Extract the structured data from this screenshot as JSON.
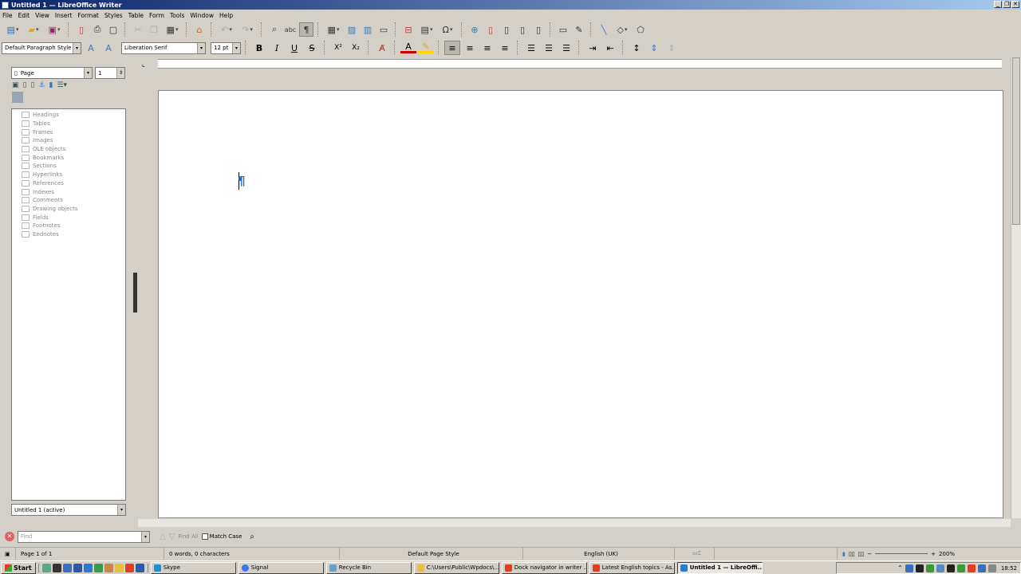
{
  "window": {
    "title": "Untitled 1 — LibreOffice Writer",
    "controls": [
      "_",
      "❐",
      "✕"
    ]
  },
  "menu": [
    "File",
    "Edit",
    "View",
    "Insert",
    "Format",
    "Styles",
    "Table",
    "Form",
    "Tools",
    "Window",
    "Help"
  ],
  "formatting": {
    "paragraph_style": "Default Paragraph Style",
    "font_name": "Liberation Serif",
    "font_size": "12 pt",
    "bold": "B",
    "italic": "I",
    "underline": "U",
    "strike": "S",
    "superscript": "X²",
    "subscript": "X₂"
  },
  "navigator": {
    "category": "Page",
    "page_number": "1",
    "items": [
      "Headings",
      "Tables",
      "Frames",
      "Images",
      "OLE objects",
      "Bookmarks",
      "Sections",
      "Hyperlinks",
      "References",
      "Indexes",
      "Comments",
      "Drawing objects",
      "Fields",
      "Footnotes",
      "Endnotes"
    ],
    "document": "Untitled 1 (active)"
  },
  "find": {
    "placeholder": "Find",
    "find_all": "Find All",
    "match_case": "Match Case"
  },
  "status": {
    "page": "Page 1 of 1",
    "words": "0 words, 0 characters",
    "page_style": "Default Page Style",
    "language": "English (UK)",
    "zoom": "200%"
  },
  "taskbar": {
    "start": "Start",
    "tasks": [
      {
        "label": "Skype",
        "color": "#1a8fd6"
      },
      {
        "label": "Signal",
        "color": "#3a76f0"
      },
      {
        "label": "Recycle Bin",
        "color": "#6aa0c8"
      },
      {
        "label": "C:\\Users\\Public\\Wpdocs\\...",
        "color": "#e8c040"
      },
      {
        "label": "Dock navigator in writer ...",
        "color": "#e04020"
      },
      {
        "label": "Latest English topics - As...",
        "color": "#e04020"
      },
      {
        "label": "Untitled 1 — LibreOffi...",
        "color": "#2a7ad4",
        "active": true
      }
    ],
    "clock": "18:52"
  }
}
